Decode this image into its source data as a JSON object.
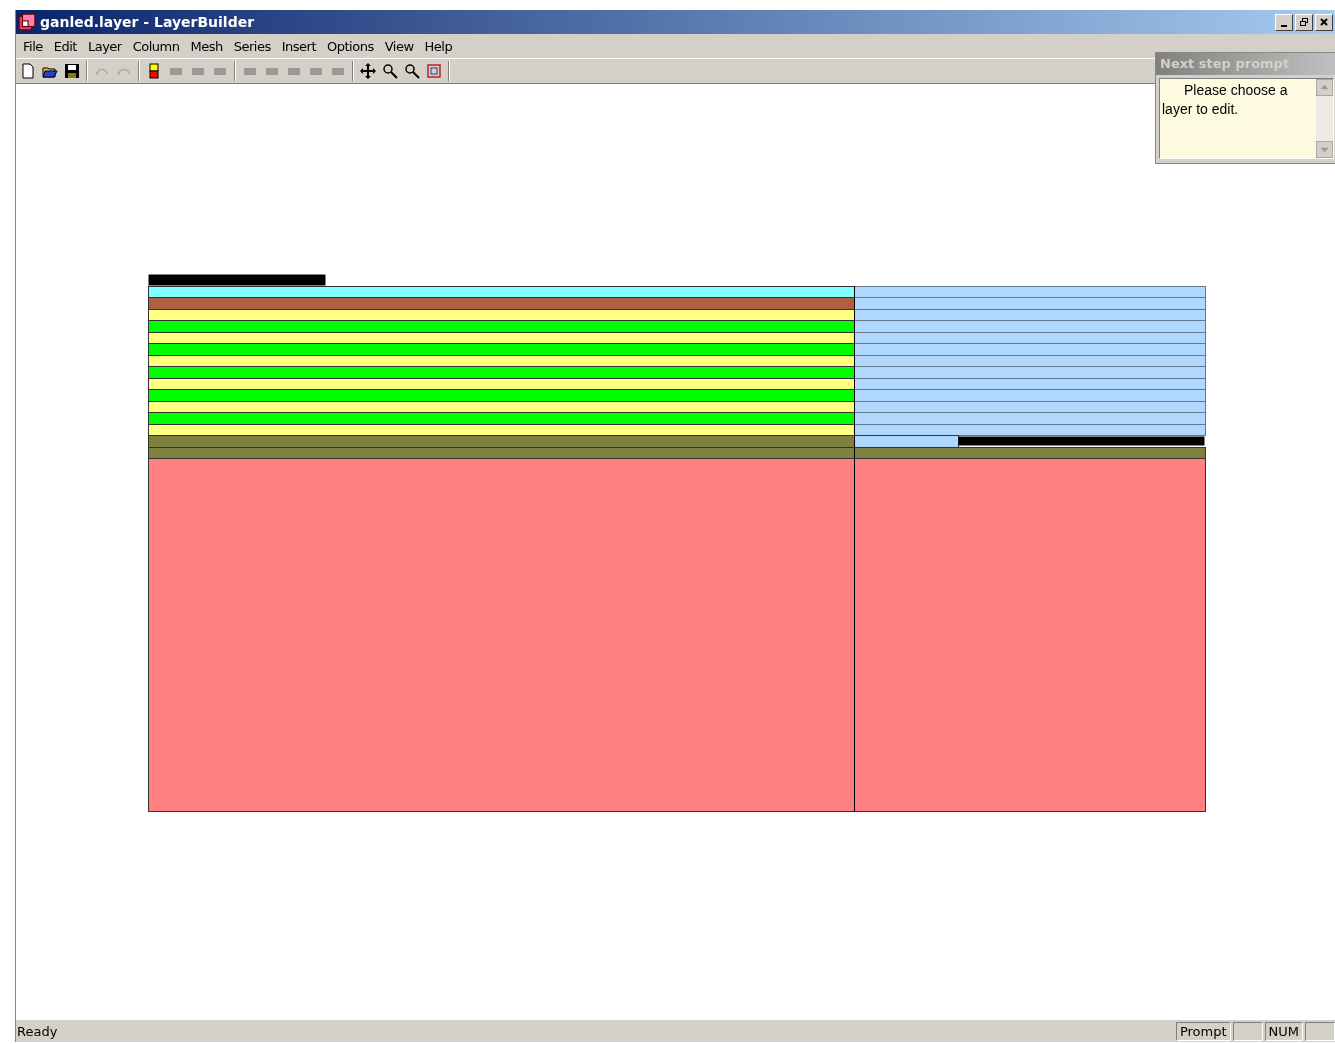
{
  "window": {
    "title": "ganled.layer - LayerBuilder"
  },
  "menu": [
    "File",
    "Edit",
    "Layer",
    "Column",
    "Mesh",
    "Series",
    "Insert",
    "Options",
    "View",
    "Help"
  ],
  "prompt_panel": {
    "title": "Next step prompt",
    "text": "Please choose a layer to edit."
  },
  "layers": [
    {
      "color": "#80ffff",
      "kind": "active"
    },
    {
      "color": "#b06040",
      "kind": "active"
    },
    {
      "color": "#ffff80",
      "kind": "active"
    },
    {
      "color": "#00ff00",
      "kind": "active"
    },
    {
      "color": "#ffff80",
      "kind": "active"
    },
    {
      "color": "#00ff00",
      "kind": "active"
    },
    {
      "color": "#ffff80",
      "kind": "active"
    },
    {
      "color": "#00ff00",
      "kind": "active"
    },
    {
      "color": "#ffff80",
      "kind": "active"
    },
    {
      "color": "#00ff00",
      "kind": "active"
    },
    {
      "color": "#ffff80",
      "kind": "active"
    },
    {
      "color": "#00ff00",
      "kind": "active"
    },
    {
      "color": "#ffff80",
      "kind": "active"
    },
    {
      "color": "#808040",
      "kind": "contact"
    },
    {
      "color": "#808040",
      "kind": "base"
    },
    {
      "color": "#ff8080",
      "kind": "substrate"
    }
  ],
  "status_bar": {
    "message": "Ready",
    "panes": [
      "Prompt",
      "NUM"
    ]
  }
}
